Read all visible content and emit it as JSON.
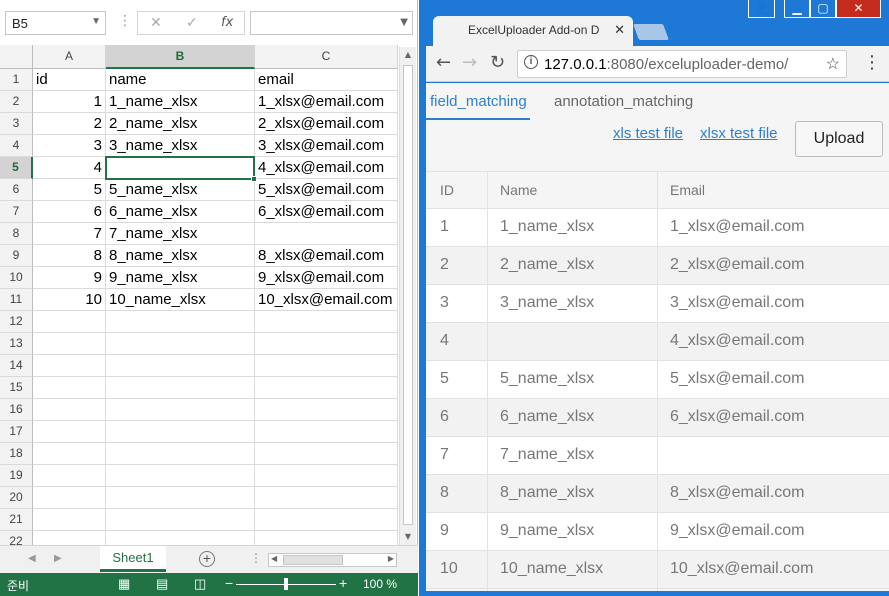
{
  "excel": {
    "name_box": "B5",
    "formula_icons": {
      "cancel": "✕",
      "confirm": "✓",
      "fx": "fx"
    },
    "formula_value": "",
    "columns": [
      "A",
      "B",
      "C"
    ],
    "selected_column": "B",
    "rows": [
      {
        "n": "1",
        "a": "id",
        "b": "name",
        "c": "email"
      },
      {
        "n": "2",
        "a": "1",
        "b": "1_name_xlsx",
        "c": "1_xlsx@email.com"
      },
      {
        "n": "3",
        "a": "2",
        "b": "2_name_xlsx",
        "c": "2_xlsx@email.com"
      },
      {
        "n": "4",
        "a": "3",
        "b": "3_name_xlsx",
        "c": "3_xlsx@email.com"
      },
      {
        "n": "5",
        "a": "4",
        "b": "",
        "c": "4_xlsx@email.com"
      },
      {
        "n": "6",
        "a": "5",
        "b": "5_name_xlsx",
        "c": "5_xlsx@email.com"
      },
      {
        "n": "7",
        "a": "6",
        "b": "6_name_xlsx",
        "c": "6_xlsx@email.com"
      },
      {
        "n": "8",
        "a": "7",
        "b": "7_name_xlsx",
        "c": ""
      },
      {
        "n": "9",
        "a": "8",
        "b": "8_name_xlsx",
        "c": "8_xlsx@email.com"
      },
      {
        "n": "10",
        "a": "9",
        "b": "9_name_xlsx",
        "c": "9_xlsx@email.com"
      },
      {
        "n": "11",
        "a": "10",
        "b": "10_name_xlsx",
        "c": "10_xlsx@email.com"
      },
      {
        "n": "12",
        "a": "",
        "b": "",
        "c": ""
      },
      {
        "n": "13",
        "a": "",
        "b": "",
        "c": ""
      },
      {
        "n": "14",
        "a": "",
        "b": "",
        "c": ""
      },
      {
        "n": "15",
        "a": "",
        "b": "",
        "c": ""
      },
      {
        "n": "16",
        "a": "",
        "b": "",
        "c": ""
      },
      {
        "n": "17",
        "a": "",
        "b": "",
        "c": ""
      },
      {
        "n": "18",
        "a": "",
        "b": "",
        "c": ""
      },
      {
        "n": "19",
        "a": "",
        "b": "",
        "c": ""
      },
      {
        "n": "20",
        "a": "",
        "b": "",
        "c": ""
      },
      {
        "n": "21",
        "a": "",
        "b": "",
        "c": ""
      },
      {
        "n": "22",
        "a": "",
        "b": "",
        "c": ""
      }
    ],
    "selected_row": "5",
    "sheet_tab": "Sheet1",
    "status_ready": "준비",
    "zoom": "100 %"
  },
  "browser": {
    "tab_title": "ExcelUploader Add-on D",
    "url_host": "127.0.0.1",
    "url_rest": ":8080/exceluploader-demo/",
    "tabs": [
      "field_matching",
      "annotation_matching"
    ],
    "active_tab": "field_matching",
    "links": [
      "xls test file",
      "xlsx test file"
    ],
    "upload_label": "Upload",
    "table": {
      "headers": [
        "ID",
        "Name",
        "Email"
      ],
      "rows": [
        [
          "1",
          "1_name_xlsx",
          "1_xlsx@email.com"
        ],
        [
          "2",
          "2_name_xlsx",
          "2_xlsx@email.com"
        ],
        [
          "3",
          "3_name_xlsx",
          "3_xlsx@email.com"
        ],
        [
          "4",
          "",
          "4_xlsx@email.com"
        ],
        [
          "5",
          "5_name_xlsx",
          "5_xlsx@email.com"
        ],
        [
          "6",
          "6_name_xlsx",
          "6_xlsx@email.com"
        ],
        [
          "7",
          "7_name_xlsx",
          ""
        ],
        [
          "8",
          "8_name_xlsx",
          "8_xlsx@email.com"
        ],
        [
          "9",
          "9_name_xlsx",
          "9_xlsx@email.com"
        ],
        [
          "10",
          "10_name_xlsx",
          "10_xlsx@email.com"
        ]
      ]
    }
  },
  "colors": {
    "excel_green": "#217346",
    "chrome_blue": "#1e78d6",
    "link_blue": "#2d7fd0"
  }
}
